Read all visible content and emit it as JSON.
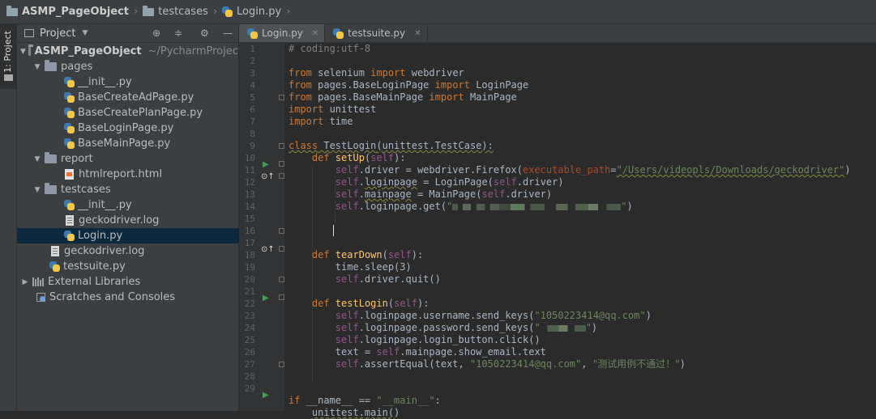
{
  "breadcrumb": {
    "project": "ASMP_PageObject",
    "folder": "testcases",
    "file": "Login.py"
  },
  "left_toolbar": {
    "project_tab": "1: Project"
  },
  "project_panel": {
    "title": "Project",
    "root_name": "ASMP_PageObject",
    "root_path": "~/PycharmProject",
    "tree": {
      "pages": "pages",
      "init1": "__init__.py",
      "basecreatead": "BaseCreateAdPage.py",
      "basecreateplan": "BaseCreatePlanPage.py",
      "baselogin": "BaseLoginPage.py",
      "basemain": "BaseMainPage.py",
      "report": "report",
      "htmlreport": "htmlreport.html",
      "testcases": "testcases",
      "init2": "__init__.py",
      "geckolog1": "geckodriver.log",
      "login": "Login.py",
      "geckolog2": "geckodriver.log",
      "testsuite": "testsuite.py",
      "extlibs": "External Libraries",
      "scratches": "Scratches and Consoles"
    }
  },
  "tabs": [
    {
      "label": "Login.py",
      "active": true
    },
    {
      "label": "testsuite.py",
      "active": false
    }
  ],
  "code": {
    "line_numbers": [
      "1",
      "2",
      "3",
      "4",
      "5",
      "6",
      "7",
      "8",
      "9",
      "10",
      "11",
      "12",
      "13",
      "14",
      "15",
      "16",
      "17",
      "18",
      "19",
      "20",
      "21",
      "22",
      "23",
      "24",
      "25",
      "26",
      "27",
      "28",
      "29"
    ],
    "l1": "# coding:utf-8",
    "from": "from",
    "import": "import",
    "selenium": " selenium ",
    "webdriver": " webdriver",
    "m_login": " pages.BaseLoginPage ",
    "c_login": " LoginPage",
    "m_main": " pages.BaseMainPage ",
    "c_main": " MainPage",
    "unittest": " unittest",
    "time": " time",
    "class_kw": "class",
    "class_name": " TestLogin",
    "class_base": "(unittest.TestCase):",
    "def": "def",
    "self": "self",
    "setup": "setUp",
    "teardown": "tearDown",
    "testlogin": "testLogin",
    "fn_args_open": "(",
    "fn_args_close": "):",
    "l11_a": ".driver = webdriver.Firefox(",
    "l11_param": "executable_path",
    "l11_eq": "=",
    "l11_str": "\"/Users/videopls/Downloads/geckodriver\"",
    "l11_close": ")",
    "l12_attr": "loginpage",
    "l12_b": " = LoginPage(",
    "l12_c": ".driver)",
    "l13_attr": "mainpage",
    "l13_b": " = MainPage(",
    "l13_c": ".driver)",
    "l14_a": ".loginpage.get(",
    "l14_str_open": "\"",
    "l14_str_close": "\"",
    "l14_close": ")",
    "l17": "time.sleep(3)",
    "l18": ".driver.quit()",
    "l21_a": ".loginpage.username.send_keys(",
    "l21_str": "\"1050223414@qq.com\"",
    "l21_close": ")",
    "l22_a": ".loginpage.password.send_keys(",
    "l22_str_open": "\"",
    "l22_str_close": "\"",
    "l22_close": ")",
    "l23": ".loginpage.login_button.click()",
    "l24_a": "text = ",
    "l24_b": ".mainpage.show_email.text",
    "l25_a": ".assertEqual(text, ",
    "l25_str1": "\"1050223414@qq.com\"",
    "l25_comma": ", ",
    "l25_str2": "\"测试用例不通过！\"",
    "l25_close": ")",
    "if_kw": "if",
    "l28_a": " __name__ == ",
    "l28_str": "\"__main__\"",
    "l28_b": ":",
    "l29": "unittest.main()"
  },
  "colors": {
    "keyword": "#cc7832",
    "self": "#94558d",
    "string": "#6a8759",
    "function": "#ffc66d",
    "comment": "#808080",
    "param": "#aa4926"
  }
}
